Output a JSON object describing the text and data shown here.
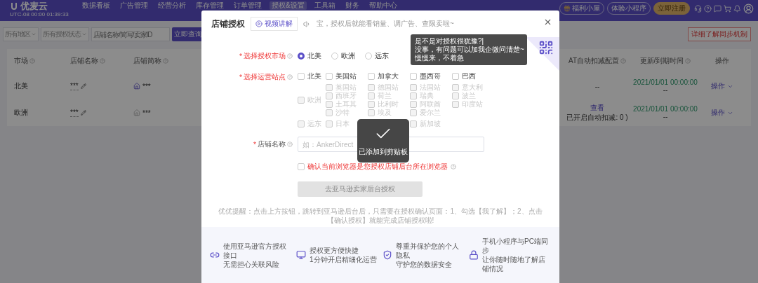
{
  "header": {
    "logo": "优麦云",
    "clock": "UTC-08 00:00 01:39:33",
    "nav": [
      {
        "label": "数据看板",
        "selected": false
      },
      {
        "label": "广告管理",
        "selected": false
      },
      {
        "label": "经营分析",
        "selected": false
      },
      {
        "label": "库存管理",
        "selected": false
      },
      {
        "label": "订单管理",
        "selected": false
      },
      {
        "label": "授权&设置",
        "selected": true
      },
      {
        "label": "工具箱",
        "selected": false
      },
      {
        "label": "财务",
        "selected": false
      },
      {
        "label": "帮助中心",
        "selected": false
      }
    ],
    "actions": [
      {
        "label": "福利小屋",
        "kind": "gift"
      },
      {
        "label": "体验小程序",
        "kind": "outline"
      },
      {
        "label": "立即注册",
        "kind": "gold"
      }
    ]
  },
  "filters": {
    "region": "所有地区",
    "status": "所有授权状态",
    "search_placeholder": "店铺名称/简写/卖家ID",
    "query_button": "立即查询",
    "sync_button": "详细了解同步机制"
  },
  "table": {
    "columns": [
      "市场",
      "店铺名称",
      "店铺简称",
      "AT自动扣减配置",
      "更新/到期时间",
      "操作"
    ],
    "rows": [
      {
        "market": "北美",
        "name": "***",
        "short_name": "***",
        "home_highlighted": true,
        "at_config": "--",
        "at_note": "",
        "updated": "2021/01/01 00:00:00",
        "expires": "--",
        "action": "操作"
      },
      {
        "market": "欧洲",
        "name": "***",
        "short_name": "***",
        "home_highlighted": false,
        "at_config": "查看",
        "at_note": "已开启自动扣减: 0 )",
        "updated": "2021/01/01 00:00:00",
        "expires": "--",
        "action": "操作"
      }
    ]
  },
  "dialog": {
    "title": "店铺授权",
    "video_button": "视频讲解",
    "notice": "宝，授权后就能看销量、调广告、查限卖啦~",
    "tooltip": [
      "是不是对授权很犹豫?|",
      "没事，有问题可以加我企微问清楚~",
      "慢慢来，不着急"
    ],
    "market_label": {
      "mark": "*",
      "text": "选择授权市场"
    },
    "markets": [
      {
        "label": "北美",
        "selected": true
      },
      {
        "label": "欧洲",
        "selected": false
      },
      {
        "label": "远东",
        "selected": false
      }
    ],
    "sites_label": {
      "mark": "*",
      "text": "选择运营站点"
    },
    "site_groups": [
      {
        "region": {
          "label": "北美",
          "checked": false,
          "disabled": false
        },
        "sites": [
          {
            "label": "美国站",
            "checked": false,
            "disabled": false
          },
          {
            "label": "加拿大",
            "checked": false,
            "disabled": false
          },
          {
            "label": "墨西哥",
            "checked": false,
            "disabled": false
          },
          {
            "label": "巴西",
            "checked": false,
            "disabled": false
          }
        ]
      },
      {
        "region": {
          "label": "欧洲",
          "checked": false,
          "disabled": true
        },
        "sites": [
          {
            "label": "英国站",
            "checked": false,
            "disabled": true
          },
          {
            "label": "德国站",
            "checked": false,
            "disabled": true
          },
          {
            "label": "法国站",
            "checked": false,
            "disabled": true
          },
          {
            "label": "意大利",
            "checked": false,
            "disabled": true
          },
          {
            "label": "西班牙",
            "checked": false,
            "disabled": true
          },
          {
            "label": "荷兰",
            "checked": false,
            "disabled": true
          },
          {
            "label": "瑞典",
            "checked": false,
            "disabled": true
          },
          {
            "label": "波兰",
            "checked": false,
            "disabled": true
          },
          {
            "label": "土耳其",
            "checked": false,
            "disabled": true
          },
          {
            "label": "比利时",
            "checked": false,
            "disabled": true
          },
          {
            "label": "阿联酋",
            "checked": false,
            "disabled": true
          },
          {
            "label": "印度站",
            "checked": false,
            "disabled": true
          },
          {
            "label": "沙特",
            "checked": false,
            "disabled": true
          },
          {
            "label": "埃及",
            "checked": false,
            "disabled": true
          },
          {
            "label": "爱尔兰",
            "checked": false,
            "disabled": true
          }
        ]
      },
      {
        "region": {
          "label": "远东",
          "checked": false,
          "disabled": true
        },
        "sites": [
          {
            "label": "日本",
            "checked": false,
            "disabled": true
          },
          {
            "label": "新加坡",
            "checked": false,
            "disabled": true
          }
        ]
      }
    ],
    "name_label": {
      "mark": "*",
      "text": "店铺名称"
    },
    "name_placeholder": "如：AnkerDirect",
    "confirm": {
      "label": "确认当前浏览器是您授权店铺后台所在浏览器",
      "checked": false
    },
    "submit": {
      "label": "去亚马逊卖家后台授权",
      "disabled": true
    },
    "tip": "优优提醒：点击上方按钮，跳转到亚马逊后台后，只需要在授权确认页面：1、勾选【我了解】；2、点击【确认授权】就能完成店铺授权啦!",
    "features": [
      {
        "title": "使用亚马逊官方授权接口",
        "subtitle": "无需担心关联风险"
      },
      {
        "title": "授权更方便快捷",
        "subtitle": "1分钟开启精细化运营"
      },
      {
        "title": "尊重并保护您的个人隐私",
        "subtitle": "守护您的数据安全"
      },
      {
        "title": "手机小程序与PC端同步",
        "subtitle": "让你随时随地了解店铺情况"
      }
    ],
    "toast": "已添加到剪贴板"
  }
}
